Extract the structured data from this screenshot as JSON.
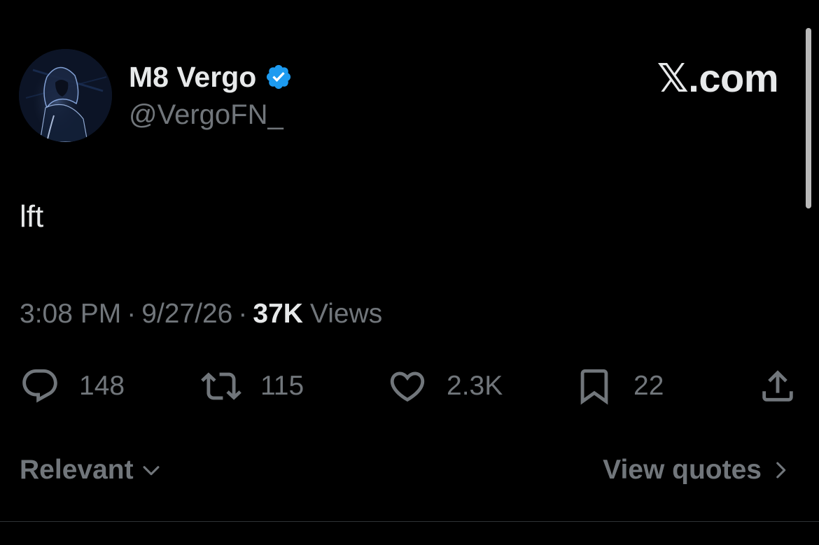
{
  "author": {
    "display_name": "M8 Vergo",
    "handle": "@VergoFN_",
    "verified": true,
    "avatar_icon": "hooded-figure-avatar"
  },
  "source_label": "𝕏.com",
  "tweet": {
    "text": "lft"
  },
  "meta": {
    "time": "3:08 PM",
    "separator": "·",
    "date": "9/27/26",
    "views_count": "37K",
    "views_label": "Views"
  },
  "actions": {
    "replies": "148",
    "retweets": "115",
    "likes": "2.3K",
    "bookmarks": "22"
  },
  "footer": {
    "sort_label": "Relevant",
    "view_quotes_label": "View quotes"
  },
  "colors": {
    "background": "#000000",
    "primary_text": "#e7e9ea",
    "secondary_text": "#71767b",
    "verified_badge": "#1d9bf0",
    "divider": "#2f3336"
  }
}
